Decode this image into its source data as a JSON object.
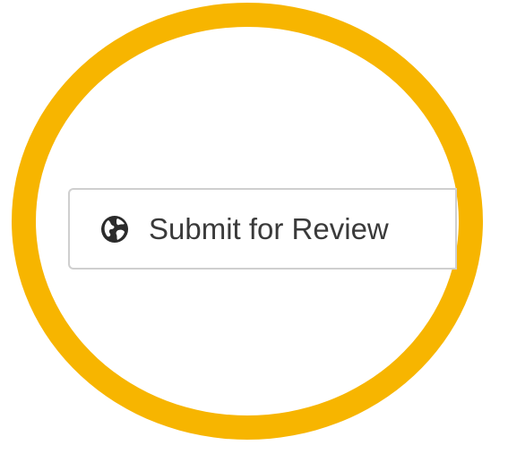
{
  "submit_button": {
    "label": "Submit for Review",
    "icon": "globe-icon"
  },
  "highlight": {
    "color": "#f7b500"
  }
}
